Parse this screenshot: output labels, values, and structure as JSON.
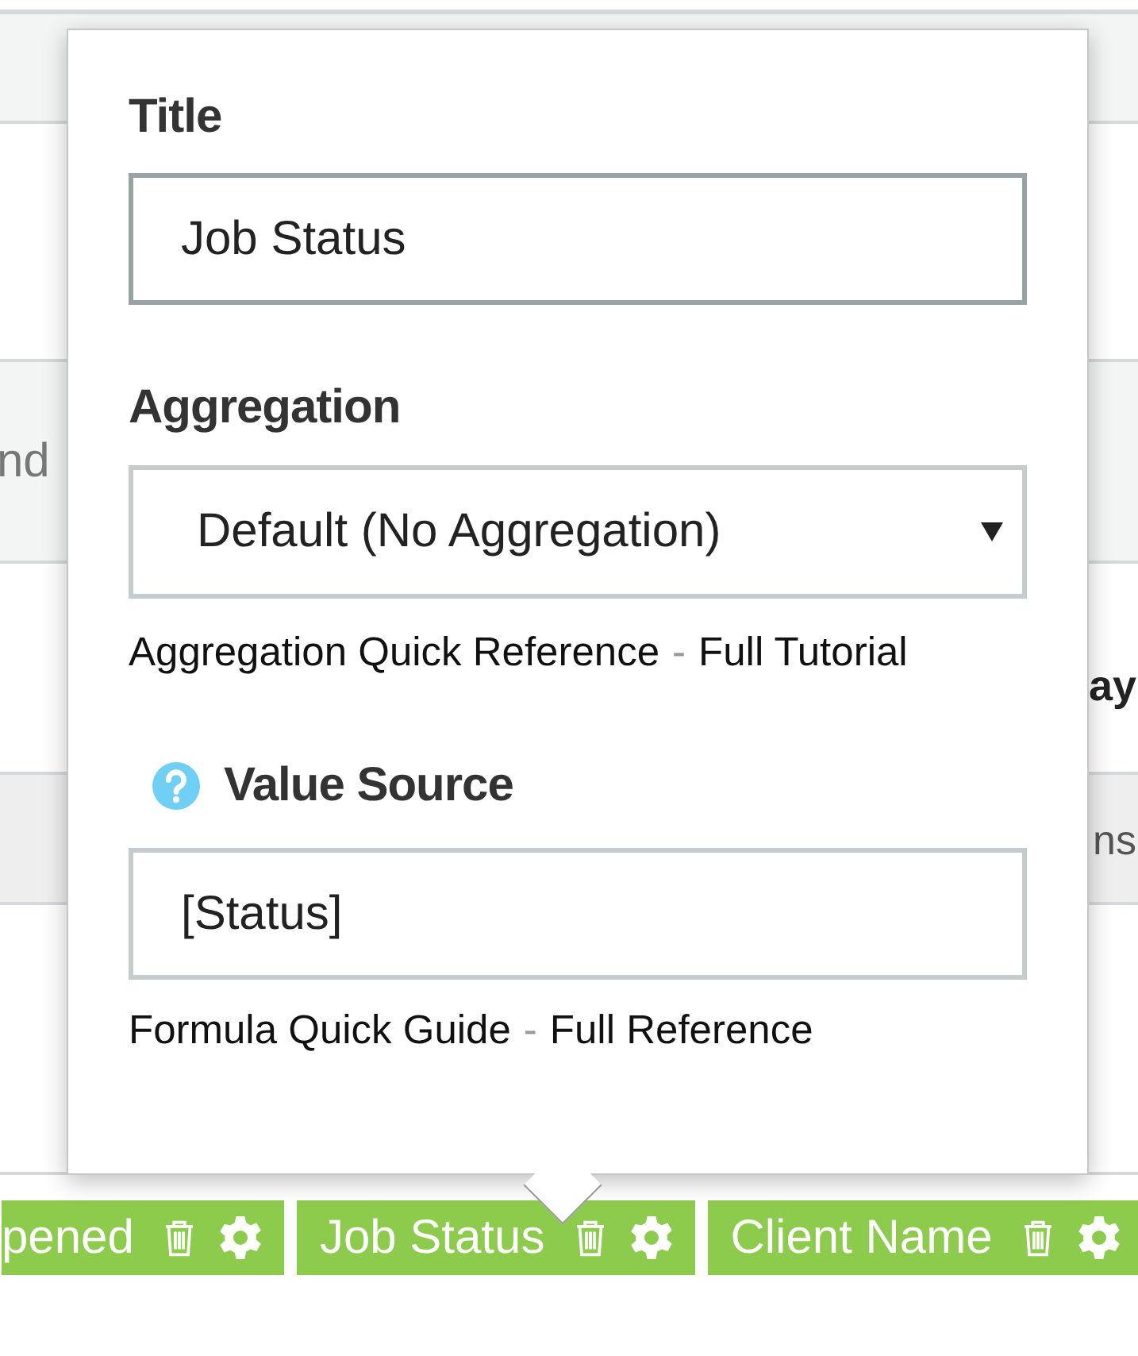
{
  "background": {
    "band_text_left": "nd",
    "band_text_bold": "ay",
    "band_text_right": "ns"
  },
  "editor": {
    "title_label": "Title",
    "title_value": "Job Status",
    "aggregation_label": "Aggregation",
    "aggregation_value": "Default (No Aggregation)",
    "aggregation_links": [
      "Aggregation Quick Reference",
      "Full Tutorial"
    ],
    "link_separator": "-",
    "value_source_label": "Value Source",
    "value_source_value": "[Status]",
    "formula_links": [
      "Formula Quick Guide",
      "Full Reference"
    ]
  },
  "columns": [
    {
      "label": "pened",
      "selected": false
    },
    {
      "label": "Job Status",
      "selected": true
    },
    {
      "label": "Client Name",
      "selected": false
    }
  ]
}
